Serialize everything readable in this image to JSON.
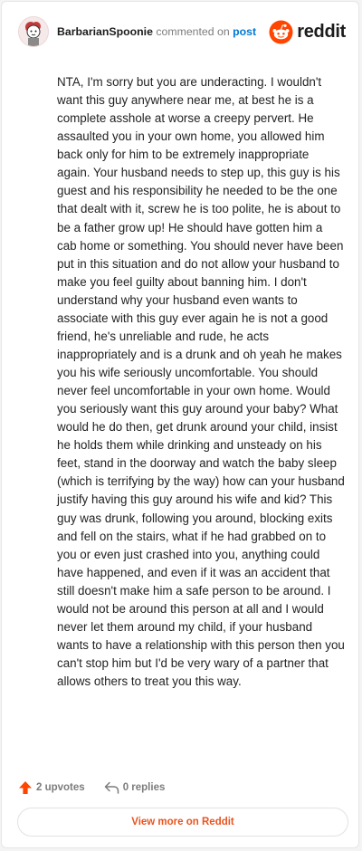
{
  "header": {
    "username": "BarbarianSpoonie",
    "action_text": " commented on ",
    "post_link": "post",
    "brand_name": "reddit"
  },
  "comment": {
    "body": "NTA, I'm sorry but you are underacting. I wouldn't want this guy anywhere near me, at best he is a complete asshole at worse a creepy pervert. He assaulted you in your own home, you allowed him back only for him to be extremely inappropriate again. Your husband needs to step up, this guy is his guest and his responsibility he needed to be the one that dealt with it, screw he is too polite, he is about to be a father grow up! He should have gotten him a cab home or something. You should never have been put in this situation and do not allow your husband to make you feel guilty about banning him. I don't understand why your husband even wants to associate with this guy ever again he is not a good friend, he's unreliable and rude, he acts inappropriately and is a drunk and oh yeah he makes you his wife seriously uncomfortable. You should never feel uncomfortable in your own home. Would you seriously want this guy around your baby? What would he do then, get drunk around your child, insist he holds them while drinking and unsteady on his feet, stand in the doorway and watch the baby sleep (which is terrifying by the way) how can your husband justify having this guy around his wife and kid? This guy was drunk, following you around, blocking exits and fell on the stairs, what if he had grabbed on to you or even just crashed into you, anything could have happened, and even if it was an accident that still doesn't make him a safe person to be around. I would not be around this person at all and I would never let them around my child, if your husband wants to have a relationship with this person then you can't stop him but I'd be very wary of a partner that allows others to treat you this way."
  },
  "actions": {
    "upvotes": "2 upvotes",
    "replies": "0 replies"
  },
  "view_more_label": "View more on Reddit",
  "icons": {
    "avatar": "avatar",
    "brand": "reddit-logo-icon",
    "upvote": "upvote-arrow-icon",
    "reply": "reply-arrow-icon"
  },
  "colors": {
    "upvote": "#ff4500",
    "link": "#0079d3",
    "view_more": "#e8541f",
    "muted": "#7c7c7c"
  }
}
